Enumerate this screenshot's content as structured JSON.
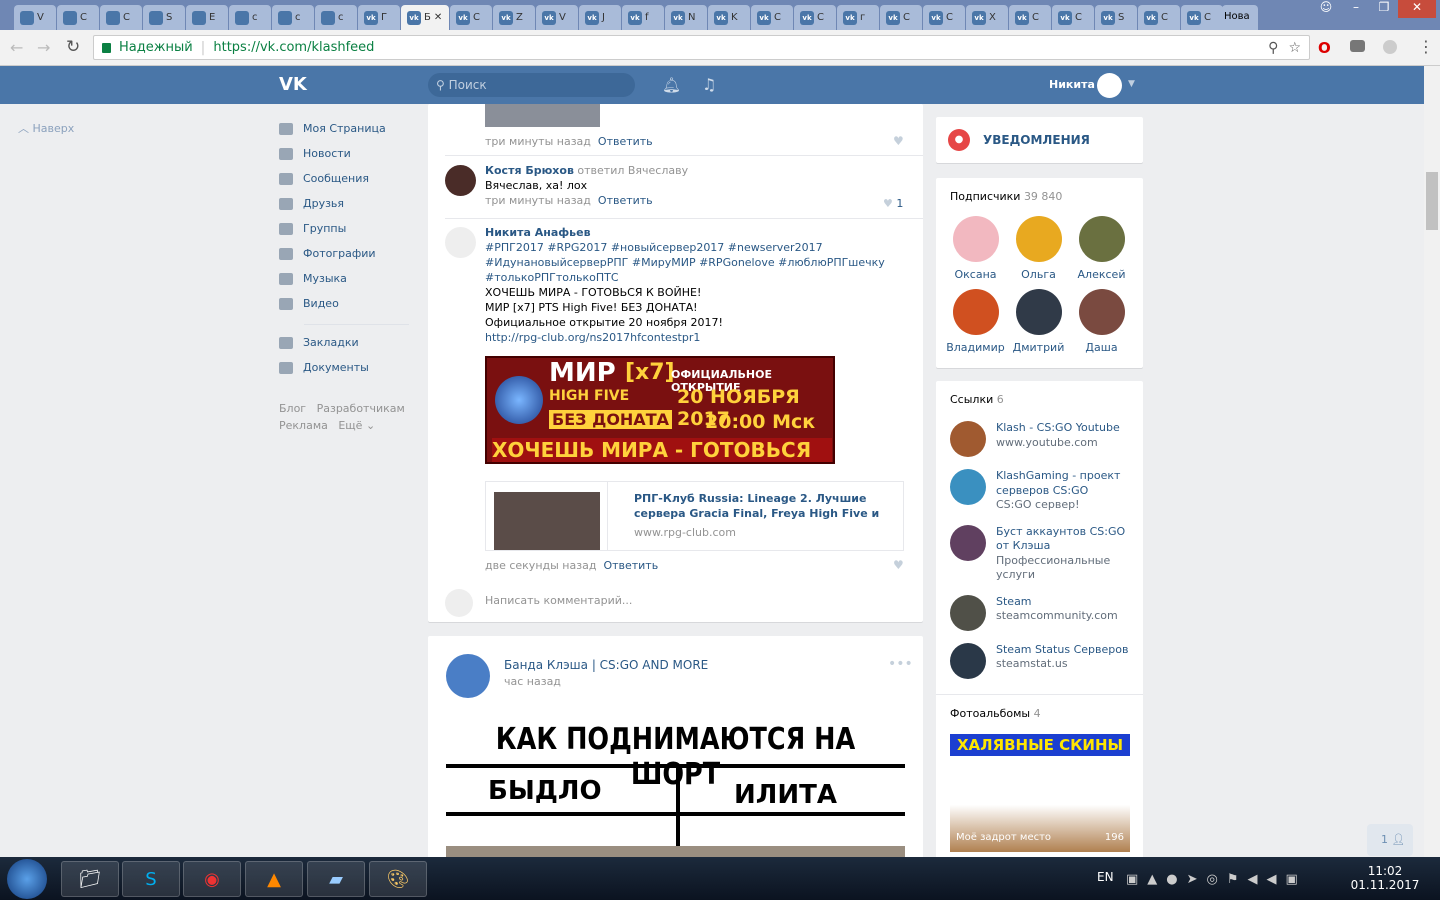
{
  "browser": {
    "tabs": [
      "V",
      "C",
      "C",
      "S",
      "E",
      "c",
      "c",
      "c",
      "Г",
      "Б",
      "C",
      "Z",
      "V",
      "J",
      "f",
      "N",
      "K",
      "C",
      "C",
      "г",
      "C",
      "C",
      "X",
      "C",
      "C",
      "S",
      "C",
      "C"
    ],
    "new_tab_label": "Нова",
    "secure_label": "Надежный",
    "url": "https://vk.com/klashfeed"
  },
  "header": {
    "search_placeholder": "Поиск",
    "user_name": "Никита"
  },
  "left": {
    "back_to_top": "Наверх"
  },
  "nav": {
    "items": [
      "Моя Страница",
      "Новости",
      "Сообщения",
      "Друзья",
      "Группы",
      "Фотографии",
      "Музыка",
      "Видео"
    ],
    "items2": [
      "Закладки",
      "Документы"
    ],
    "footer": [
      "Блог",
      "Разработчикам",
      "Реклама",
      "Ещё"
    ]
  },
  "feed": {
    "c0": {
      "time": "три минуты назад",
      "reply": "Ответить"
    },
    "c1": {
      "author": "Костя Брюхов",
      "replied": "ответил Вячеславу",
      "text": "Вячеслав, ха! лох",
      "time": "три минуты назад",
      "reply": "Ответить",
      "likes": "1"
    },
    "c2": {
      "author": "Никита Анафьев",
      "lines": [
        "#РПГ2017 #RPG2017 #новыйсервер2017 #newserver2017",
        "#ИдунановыйсерверРПГ #МируМИР #RPGonelove #люблюРПГшечку",
        "#толькоРПГтолькоПТС",
        "ХОЧЕШЬ МИРА - ГОТОВЬСЯ К ВОЙНЕ!",
        "МИР [x7] PTS High Five! БЕЗ ДОНАТА!",
        "Официальное открытие 20 ноября 2017!"
      ],
      "url": "http://rpg-club.org/ns2017hfcontestpr1",
      "banner": {
        "t1": "МИР",
        "t2": "[x7]",
        "t3": "ОФИЦИАЛЬНОЕ ОТКРЫТИЕ",
        "t4": "HIGH FIVE",
        "t5": "20 НОЯБРЯ 2017",
        "t6": "БЕЗ ДОНАТА",
        "t7": "20:00 Мск",
        "t8": "ХОЧЕШЬ МИРА - ГОТОВЬСЯ К ВОЙНЕ"
      },
      "snippet": {
        "title": "РПГ-Клуб Russia: Lineage 2. Лучшие сервера Gracia Final, Freya High Five и GoD. Официальна...",
        "domain": "www.rpg-club.com"
      },
      "time": "две секунды назад",
      "reply": "Ответить"
    },
    "comment_placeholder": "Написать комментарий...",
    "post2": {
      "author": "Банда Клэша | CS:GO AND MORE",
      "time": "час назад",
      "meme_title": "КАК ПОДНИМАЮТСЯ НА ШОРТ",
      "left": "БЫДЛО",
      "right": "ИЛИТА"
    }
  },
  "right": {
    "notifications": "УВЕДОМЛЕНИЯ",
    "subs_title": "Подписчики",
    "subs_count": "39 840",
    "subs": [
      "Оксана",
      "Ольга",
      "Алексей",
      "Владимир",
      "Дмитрий",
      "Даша"
    ],
    "links_title": "Ссылки",
    "links_count": "6",
    "links": [
      {
        "t": "Klash - CS:GO Youtube",
        "s": "www.youtube.com"
      },
      {
        "t": "KlashGaming - проект серверов CS:GO",
        "s": "CS:GO сервер!"
      },
      {
        "t": "Буст аккаунтов CS:GO от Клэша",
        "s": "Профессиональные услуги"
      },
      {
        "t": "Steam",
        "s": "steamcommunity.com"
      },
      {
        "t": "Steam Status Серверов",
        "s": "steamstat.us"
      }
    ],
    "albums_title": "Фотоальбомы",
    "albums_count": "4",
    "album": {
      "title": "ХАЛЯВНЫЕ СКИНЫ",
      "caption": "Моё задрот место",
      "count": "196"
    }
  },
  "chat_badge": "1",
  "taskbar": {
    "lang": "EN",
    "time": "11:02",
    "date": "01.11.2017"
  }
}
